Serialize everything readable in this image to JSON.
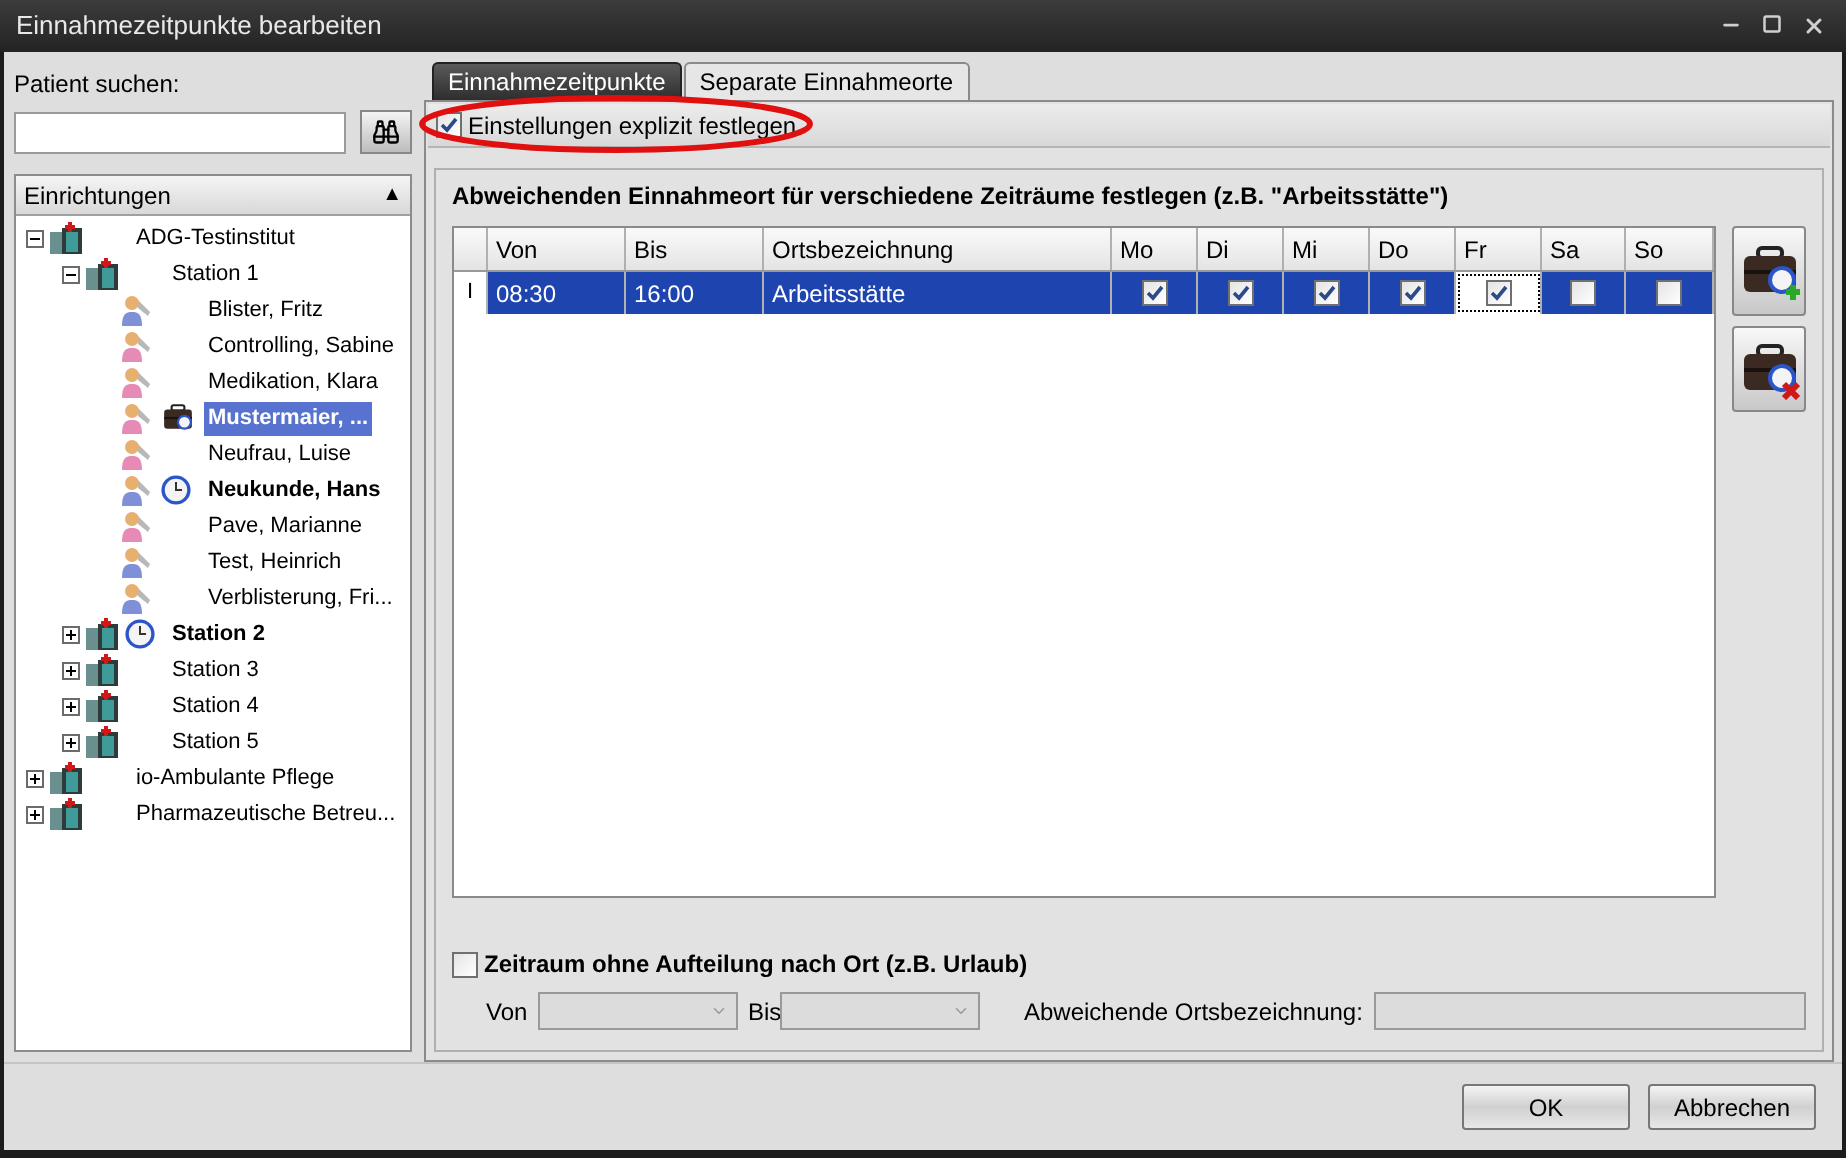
{
  "window": {
    "title": "Einnahmezeitpunkte bearbeiten"
  },
  "patient_search": {
    "label": "Patient suchen:"
  },
  "tree": {
    "header": "Einrichtungen",
    "header_glyph": "▲",
    "items": [
      {
        "label": "ADG-Testinstitut",
        "kind": "facility",
        "expanded": true,
        "children": [
          {
            "label": "Station 1",
            "kind": "facility",
            "expanded": true,
            "children": [
              {
                "label": "Blister, Fritz",
                "kind": "male"
              },
              {
                "label": "Controlling, Sabine",
                "kind": "female"
              },
              {
                "label": "Medikation, Klara",
                "kind": "female"
              },
              {
                "label": "Mustermaier, ...",
                "kind": "female",
                "briefcase": true,
                "bold": true,
                "selected": true
              },
              {
                "label": "Neufrau, Luise",
                "kind": "female"
              },
              {
                "label": "Neukunde, Hans",
                "kind": "male",
                "clock": true,
                "bold": true
              },
              {
                "label": "Pave, Marianne",
                "kind": "female"
              },
              {
                "label": "Test, Heinrich",
                "kind": "male"
              },
              {
                "label": "Verblisterung, Fri...",
                "kind": "male"
              }
            ]
          },
          {
            "label": "Station 2",
            "kind": "facility",
            "expanded": false,
            "clock": true,
            "bold": true
          },
          {
            "label": "Station 3",
            "kind": "facility",
            "expanded": false
          },
          {
            "label": "Station 4",
            "kind": "facility",
            "expanded": false
          },
          {
            "label": "Station 5",
            "kind": "facility",
            "expanded": false
          }
        ]
      },
      {
        "label": "io-Ambulante Pflege",
        "kind": "facility",
        "expanded": false
      },
      {
        "label": "Pharmazeutische Betreu...",
        "kind": "facility",
        "expanded": false
      }
    ]
  },
  "tabs": [
    {
      "label": "Einnahmezeitpunkte",
      "selected": false
    },
    {
      "label": "Separate Einnahmeorte",
      "selected": true
    }
  ],
  "explicit": {
    "label": "Einstellungen explizit festlegen",
    "checked": true
  },
  "section_title": "Abweichenden Einnahmeort für verschiedene Zeiträume festlegen (z.B. \"Arbeitsstätte\")",
  "table": {
    "columns": [
      "Von",
      "Bis",
      "Ortsbezeichnung",
      "Mo",
      "Di",
      "Mi",
      "Do",
      "Fr",
      "Sa",
      "So"
    ],
    "rows": [
      {
        "marker": "I",
        "selected": true,
        "von": "08:30",
        "bis": "16:00",
        "ort": "Arbeitsstätte",
        "days": [
          {
            "checked": true,
            "focused": false
          },
          {
            "checked": true,
            "focused": false
          },
          {
            "checked": true,
            "focused": false
          },
          {
            "checked": true,
            "focused": false
          },
          {
            "checked": true,
            "focused": true
          },
          {
            "checked": false,
            "focused": false
          },
          {
            "checked": false,
            "focused": false
          }
        ]
      }
    ]
  },
  "no_split": {
    "label": "Zeitraum ohne Aufteilung nach Ort (z.B. Urlaub)",
    "checked": false
  },
  "von_label": "Von",
  "bis_label": "Bis",
  "ort_label": "Abweichende Ortsbezeichnung:",
  "buttons": [
    "OK",
    "Abbrechen"
  ]
}
